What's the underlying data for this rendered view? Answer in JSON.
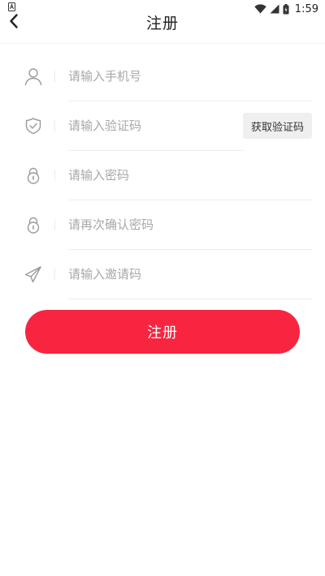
{
  "status_bar": {
    "time": "1:59",
    "icons": [
      "app-notification-icon",
      "wifi-icon",
      "signal-icon",
      "battery-icon"
    ]
  },
  "header": {
    "title": "注册",
    "back_icon": "chevron-left-icon"
  },
  "form": {
    "phone": {
      "placeholder": "请输入手机号",
      "value": "",
      "icon": "user-icon"
    },
    "code": {
      "placeholder": "请输入验证码",
      "value": "",
      "icon": "shield-check-icon",
      "button_label": "获取验证码"
    },
    "password": {
      "placeholder": "请输入密码",
      "value": "",
      "icon": "lock-icon"
    },
    "confirm_password": {
      "placeholder": "请再次确认密码",
      "value": "",
      "icon": "lock-icon"
    },
    "invite": {
      "placeholder": "请输入邀请码",
      "value": "",
      "icon": "paper-plane-icon"
    }
  },
  "submit": {
    "label": "注册"
  },
  "colors": {
    "accent": "#f72540",
    "icon_gray": "#9a9a9a",
    "placeholder": "#a8a8a8",
    "divider": "#eeeeee"
  }
}
